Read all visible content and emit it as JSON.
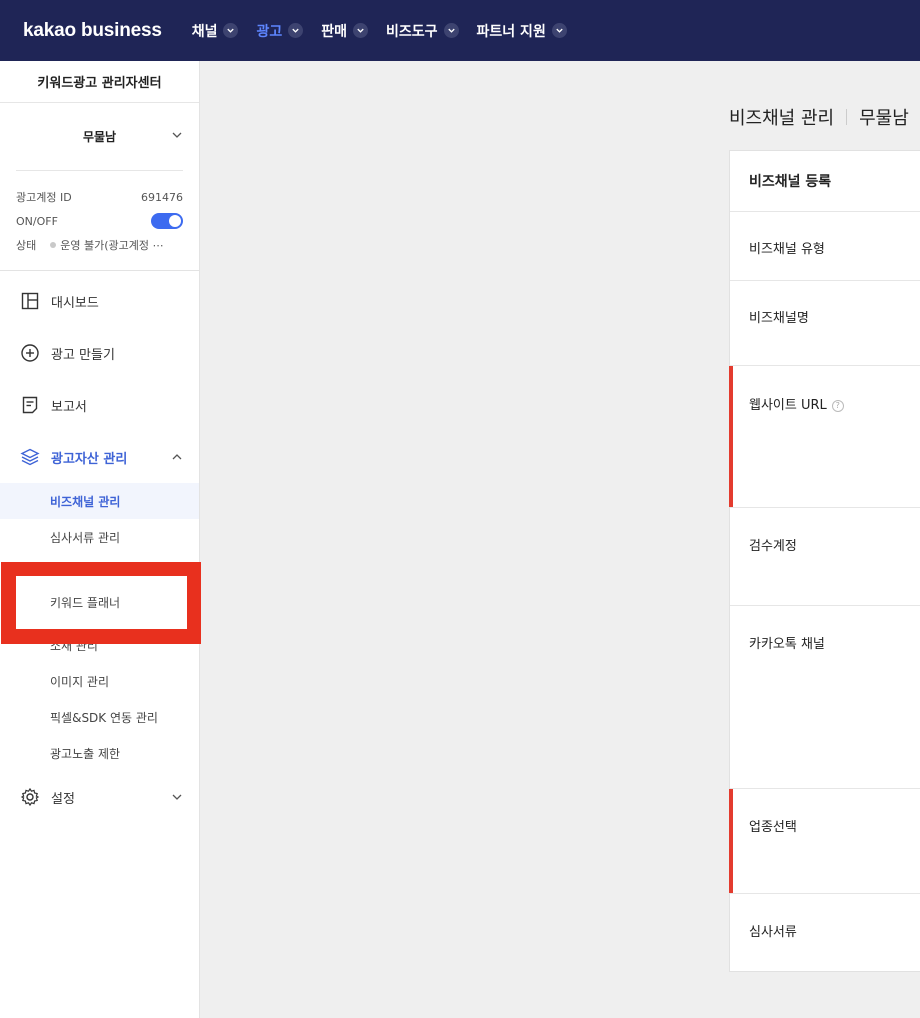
{
  "topbar": {
    "logo": "kakao business",
    "nav": [
      {
        "label": "채널"
      },
      {
        "label": "광고"
      },
      {
        "label": "판매"
      },
      {
        "label": "비즈도구"
      },
      {
        "label": "파트너 지원"
      }
    ]
  },
  "sidebar": {
    "title": "키워드광고 관리자센터",
    "account_name": "무물남",
    "ad_account_id_label": "광고계정 ID",
    "ad_account_id_value": "691476",
    "onoff_label": "ON/OFF",
    "onoff_value": "on",
    "status_label": "상태",
    "status_value": "운영 불가(광고계정 ⋯",
    "menu": [
      {
        "label": "대시보드",
        "icon": "dashboard-icon"
      },
      {
        "label": "광고 만들기",
        "icon": "plus-circle-icon"
      },
      {
        "label": "보고서",
        "icon": "report-icon"
      },
      {
        "label": "광고자산 관리",
        "icon": "layers-icon"
      }
    ],
    "submenu": [
      {
        "label": "비즈채널 관리"
      },
      {
        "label": "심사서류 관리"
      },
      {
        "label": "키워드 플래너"
      },
      {
        "label": "소재 관리"
      },
      {
        "label": "이미지 관리"
      },
      {
        "label": "픽셀&SDK 연동 관리"
      },
      {
        "label": "광고노출 제한"
      }
    ],
    "settings_label": "설정"
  },
  "main": {
    "title": "비즈채널 관리",
    "title_suffix": "무물남",
    "panel_heading": "비즈채널 등록",
    "rows": [
      {
        "label": "비즈채널 유형"
      },
      {
        "label": "비즈채널명"
      },
      {
        "label": "웹사이트 URL"
      },
      {
        "label": "검수계정"
      },
      {
        "label": "카카오톡 채널"
      },
      {
        "label": "업종선택"
      },
      {
        "label": "심사서류"
      }
    ]
  },
  "colors": {
    "topbar_bg": "#1f2556",
    "active_nav": "#5e86ff",
    "sidebar_active": "#3e63d6",
    "highlight_box": "#e8301e",
    "required_bar": "#e33b2e"
  }
}
